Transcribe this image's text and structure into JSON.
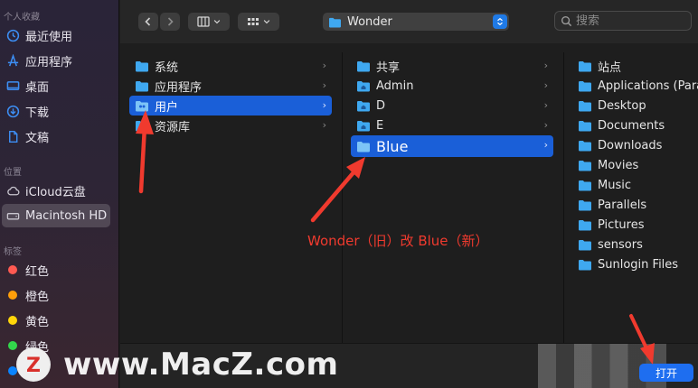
{
  "sidebar": {
    "favorites_header": "个人收藏",
    "favorites": [
      {
        "label": "最近使用",
        "icon": "clock-icon"
      },
      {
        "label": "应用程序",
        "icon": "apps-icon"
      },
      {
        "label": "桌面",
        "icon": "desktop-icon"
      },
      {
        "label": "下载",
        "icon": "download-icon"
      },
      {
        "label": "文稿",
        "icon": "document-icon"
      }
    ],
    "locations_header": "位置",
    "locations": [
      {
        "label": "iCloud云盘",
        "icon": "cloud-icon"
      },
      {
        "label": "Macintosh HD",
        "icon": "harddrive-icon",
        "selected": true
      }
    ],
    "tags_header": "标签",
    "tags": [
      {
        "label": "红色",
        "color": "#ff5a52"
      },
      {
        "label": "橙色",
        "color": "#ff9f0a"
      },
      {
        "label": "黄色",
        "color": "#ffd60a"
      },
      {
        "label": "绿色",
        "color": "#32d74b"
      },
      {
        "label": "",
        "color": "#0a84ff"
      }
    ]
  },
  "toolbar": {
    "path_label": "Wonder",
    "search_placeholder": "搜索"
  },
  "columns": [
    {
      "items": [
        {
          "label": "系统",
          "has_children": true
        },
        {
          "label": "应用程序",
          "has_children": true
        },
        {
          "label": "用户",
          "has_children": true,
          "selected": true
        },
        {
          "label": "资源库",
          "has_children": true
        }
      ]
    },
    {
      "items": [
        {
          "label": "共享",
          "has_children": true
        },
        {
          "label": "Admin",
          "has_children": true
        },
        {
          "label": "D",
          "has_children": true
        },
        {
          "label": "E",
          "has_children": true
        },
        {
          "label": "Blue",
          "has_children": true,
          "selected": true
        }
      ]
    },
    {
      "items": [
        {
          "label": "站点"
        },
        {
          "label": "Applications (Paral"
        },
        {
          "label": "Desktop"
        },
        {
          "label": "Documents"
        },
        {
          "label": "Downloads"
        },
        {
          "label": "Movies"
        },
        {
          "label": "Music"
        },
        {
          "label": "Parallels"
        },
        {
          "label": "Pictures"
        },
        {
          "label": "sensors"
        },
        {
          "label": "Sunlogin Files"
        }
      ]
    }
  ],
  "annotation": {
    "text": "Wonder（旧）改 Blue（新）",
    "color": "#f03a2e"
  },
  "bottom": {
    "open_label": "打开"
  },
  "watermark": {
    "logo_letter": "Z",
    "text": "www.MacZ.com"
  },
  "colors": {
    "accent": "#1a5fd8",
    "folder": "#3fa8f0"
  }
}
